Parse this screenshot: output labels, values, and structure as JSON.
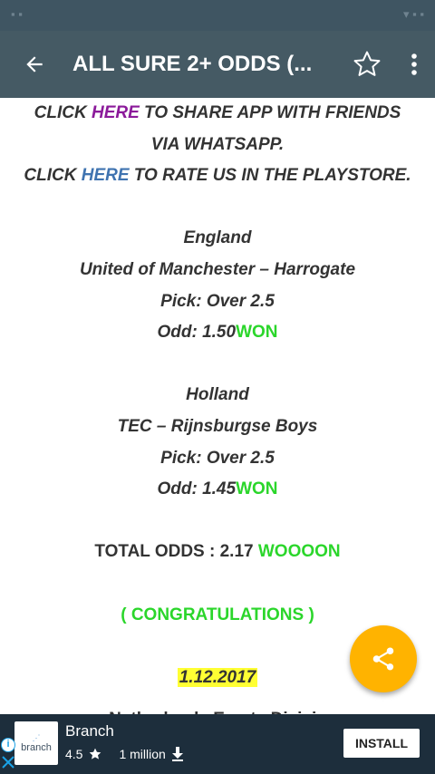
{
  "app_bar": {
    "title": "ALL SURE 2+ ODDS (...",
    "back_icon": "back-arrow-icon",
    "star_icon": "star-outline-icon",
    "menu_icon": "more-vertical-icon"
  },
  "content": {
    "share_pre": "CLICK ",
    "share_link": "HERE",
    "share_post": " TO SHARE APP WITH FRIENDS",
    "share_line2": "VIA WHATSAPP.",
    "rate_pre": "CLICK ",
    "rate_link": "HERE",
    "rate_post": " TO RATE US IN THE PLAYSTORE.",
    "matches": [
      {
        "country": "England",
        "teams": "United of Manchester  –  Harrogate",
        "pick": "Pick: Over 2.5",
        "odd": "Odd: 1.50",
        "result": "WON"
      },
      {
        "country": "Holland",
        "teams": "TEC  –  Rijnsburgse Boys",
        "pick": "Pick: Over 2.5",
        "odd": "Odd: 1.45",
        "result": "WON"
      }
    ],
    "total_label": "TOTAL ODDS : 2.17 ",
    "total_result": "WOOOON",
    "congrats": "( CONGRATULATIONS )",
    "date": "1.12.2017",
    "next_league_partial": "Netherlands Eerste Divisie"
  },
  "fab": {
    "icon": "share-icon"
  },
  "ad": {
    "app_name": "Branch",
    "logo_text": "branch",
    "rating": "4.5",
    "downloads": "1 million",
    "install_label": "INSTALL"
  },
  "colors": {
    "app_bar": "#455a64",
    "status_bar": "#3f5562",
    "link_purple": "#8b1a9a",
    "link_blue": "#3f73b0",
    "won_green": "#2bd62b",
    "fab": "#ffb300",
    "date_highlight": "#ffff33",
    "ad_bar": "#1d2e3c"
  }
}
